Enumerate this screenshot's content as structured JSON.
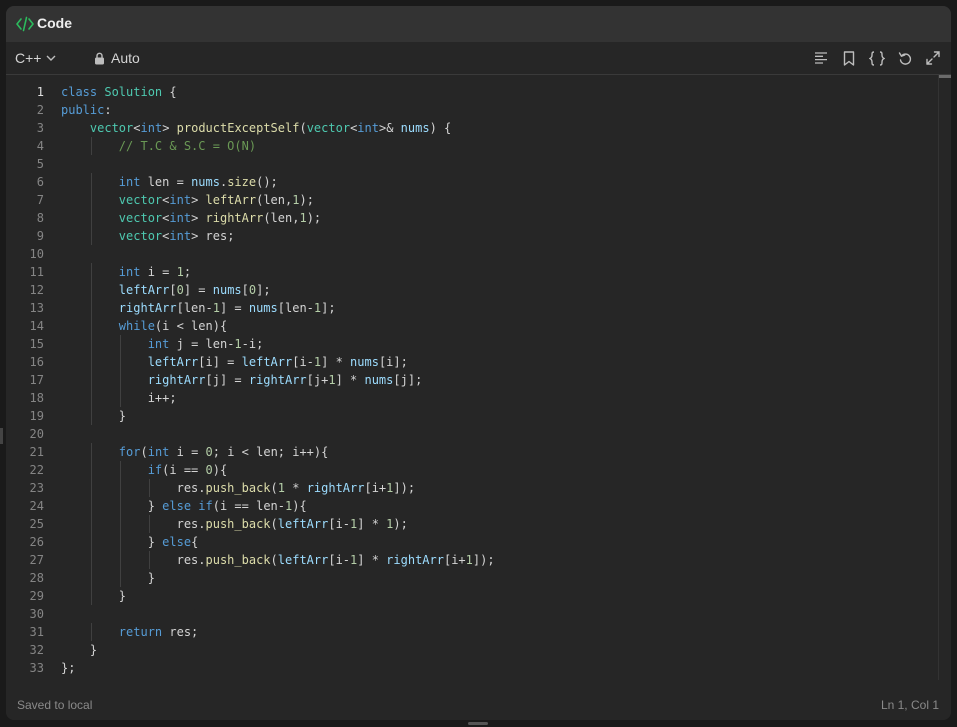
{
  "header": {
    "title": "Code"
  },
  "toolbar": {
    "language": "C++",
    "mode": "Auto",
    "icons": [
      "format-icon",
      "bookmark-icon",
      "braces-icon",
      "reset-icon",
      "expand-icon"
    ]
  },
  "editor": {
    "line_numbers": [
      "1",
      "2",
      "3",
      "4",
      "5",
      "6",
      "7",
      "8",
      "9",
      "10",
      "11",
      "12",
      "13",
      "14",
      "15",
      "16",
      "17",
      "18",
      "19",
      "20",
      "21",
      "22",
      "23",
      "24",
      "25",
      "26",
      "27",
      "28",
      "29",
      "30",
      "31",
      "32",
      "33"
    ],
    "lines": [
      "class Solution {",
      "public:",
      "    vector<int> productExceptSelf(vector<int>& nums) {",
      "        // T.C & S.C = O(N)",
      "",
      "        int len = nums.size();",
      "        vector<int> leftArr(len,1);",
      "        vector<int> rightArr(len,1);",
      "        vector<int> res;",
      "",
      "        int i = 1;",
      "        leftArr[0] = nums[0];",
      "        rightArr[len-1] = nums[len-1];",
      "        while(i < len){",
      "            int j = len-1-i;",
      "            leftArr[i] = leftArr[i-1] * nums[i];",
      "            rightArr[j] = rightArr[j+1] * nums[j];",
      "            i++;",
      "        }",
      "",
      "        for(int i = 0; i < len; i++){",
      "            if(i == 0){",
      "                res.push_back(1 * rightArr[i+1]);",
      "            } else if(i == len-1){",
      "                res.push_back(leftArr[i-1] * 1);",
      "            } else{",
      "                res.push_back(leftArr[i-1] * rightArr[i+1]);",
      "            }",
      "        }",
      "",
      "        return res;",
      "    }",
      "};"
    ]
  },
  "status": {
    "saved": "Saved to local",
    "cursor": "Ln 1, Col 1"
  },
  "colors": {
    "keyword": "#569cd6",
    "type": "#4ec9b0",
    "function": "#dcdcaa",
    "variable": "#9cdcfe",
    "number": "#b5cea8",
    "comment": "#6a9955",
    "control": "#c586c0",
    "accent": "#2cbb5d"
  }
}
